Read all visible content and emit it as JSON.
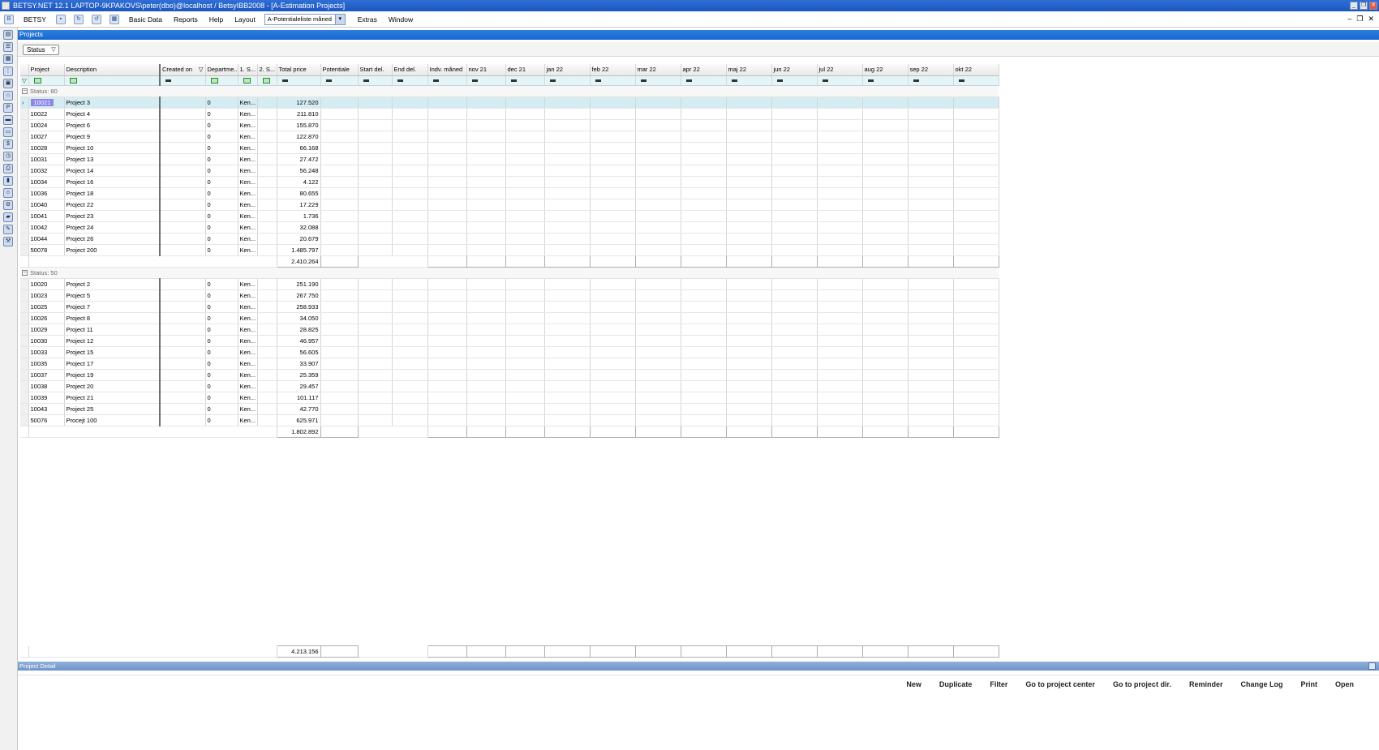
{
  "window": {
    "title": "BETSY.NET 12.1  LAPTOP-9KPAKOVS\\peter(dbo)@localhost / BetsyIBB2008 - [A-Estimation Projects]"
  },
  "menu": {
    "betsy": "BETSY",
    "basic_data": "Basic Data",
    "reports": "Reports",
    "help": "Help",
    "layout": "Layout",
    "layout_value": "A-Potentialeliste måned",
    "extras": "Extras",
    "window": "Window"
  },
  "panel": {
    "title": "Projects",
    "group_chip": "Status",
    "detail_title": "Project Detail"
  },
  "columns": {
    "project": "Project",
    "description": "Description",
    "created_on": "Created on",
    "department": "Departme...",
    "s1": "1. S...",
    "s2": "2. S...",
    "total_price": "Total price",
    "potentiale": "Potentiale",
    "start_del": "Start del.",
    "end_del": "End del.",
    "indv_maaned": "Indv. måned",
    "months": [
      "nov 21",
      "dec 21",
      "jan 22",
      "feb 22",
      "mar 22",
      "apr 22",
      "maj 22",
      "jun 22",
      "jul 22",
      "aug 22",
      "sep 22",
      "okt 22"
    ]
  },
  "groups": [
    {
      "label": "Status: 80",
      "total": "2.410.264",
      "rows": [
        {
          "id": "10021",
          "desc": "Project 3",
          "dept": "0",
          "s1": "Ken...",
          "price": "127.520"
        },
        {
          "id": "10022",
          "desc": "Project 4",
          "dept": "0",
          "s1": "Ken...",
          "price": "211.810"
        },
        {
          "id": "10024",
          "desc": "Project 6",
          "dept": "0",
          "s1": "Ken...",
          "price": "155.870"
        },
        {
          "id": "10027",
          "desc": "Project 9",
          "dept": "0",
          "s1": "Ken...",
          "price": "122.870"
        },
        {
          "id": "10028",
          "desc": "Project 10",
          "dept": "0",
          "s1": "Ken...",
          "price": "66.168"
        },
        {
          "id": "10031",
          "desc": "Project 13",
          "dept": "0",
          "s1": "Ken...",
          "price": "27.472"
        },
        {
          "id": "10032",
          "desc": "Project 14",
          "dept": "0",
          "s1": "Ken...",
          "price": "56.248"
        },
        {
          "id": "10034",
          "desc": "Project 16",
          "dept": "0",
          "s1": "Ken...",
          "price": "4.122"
        },
        {
          "id": "10036",
          "desc": "Project 18",
          "dept": "0",
          "s1": "Ken...",
          "price": "80.655"
        },
        {
          "id": "10040",
          "desc": "Project 22",
          "dept": "0",
          "s1": "Ken...",
          "price": "17.229"
        },
        {
          "id": "10041",
          "desc": "Project 23",
          "dept": "0",
          "s1": "Ken...",
          "price": "1.736"
        },
        {
          "id": "10042",
          "desc": "Project 24",
          "dept": "0",
          "s1": "Ken...",
          "price": "32.088"
        },
        {
          "id": "10044",
          "desc": "Project 26",
          "dept": "0",
          "s1": "Ken...",
          "price": "20.679"
        },
        {
          "id": "50078",
          "desc": "Project 200",
          "dept": "0",
          "s1": "Ken...",
          "price": "1.485.797"
        }
      ]
    },
    {
      "label": "Status: 50",
      "total": "1.802.892",
      "rows": [
        {
          "id": "10020",
          "desc": "Project 2",
          "dept": "0",
          "s1": "Ken...",
          "price": "251.190"
        },
        {
          "id": "10023",
          "desc": "Project 5",
          "dept": "0",
          "s1": "Ken...",
          "price": "267.750"
        },
        {
          "id": "10025",
          "desc": "Project 7",
          "dept": "0",
          "s1": "Ken...",
          "price": "258.933"
        },
        {
          "id": "10026",
          "desc": "Project 8",
          "dept": "0",
          "s1": "Ken...",
          "price": "34.050"
        },
        {
          "id": "10029",
          "desc": "Project 11",
          "dept": "0",
          "s1": "Ken...",
          "price": "28.825"
        },
        {
          "id": "10030",
          "desc": "Project 12",
          "dept": "0",
          "s1": "Ken...",
          "price": "46.957"
        },
        {
          "id": "10033",
          "desc": "Project 15",
          "dept": "0",
          "s1": "Ken...",
          "price": "56.605"
        },
        {
          "id": "10035",
          "desc": "Project 17",
          "dept": "0",
          "s1": "Ken...",
          "price": "33.907"
        },
        {
          "id": "10037",
          "desc": "Project 19",
          "dept": "0",
          "s1": "Ken...",
          "price": "25.359"
        },
        {
          "id": "10038",
          "desc": "Project 20",
          "dept": "0",
          "s1": "Ken...",
          "price": "29.457"
        },
        {
          "id": "10039",
          "desc": "Project 21",
          "dept": "0",
          "s1": "Ken...",
          "price": "101.117"
        },
        {
          "id": "10043",
          "desc": "Project 25",
          "dept": "0",
          "s1": "Ken...",
          "price": "42.770"
        },
        {
          "id": "50076",
          "desc": "Procejt 100",
          "dept": "0",
          "s1": "Ken...",
          "price": "625.971"
        }
      ]
    }
  ],
  "grand_total": "4.213.156",
  "selected_id": "10021",
  "buttons": {
    "new": "New",
    "duplicate": "Duplicate",
    "filter": "Filter",
    "go_center": "Go to project center",
    "go_dir": "Go to project dir.",
    "reminder": "Reminder",
    "change_log": "Change Log",
    "print": "Print",
    "open": "Open"
  },
  "colors": {
    "title_bar": "#1c56c0",
    "panel_header": "#1566cf",
    "selected_row": "#d4ecf2",
    "selected_id": "#8e86e8",
    "filter_row": "#e4f5f8"
  }
}
